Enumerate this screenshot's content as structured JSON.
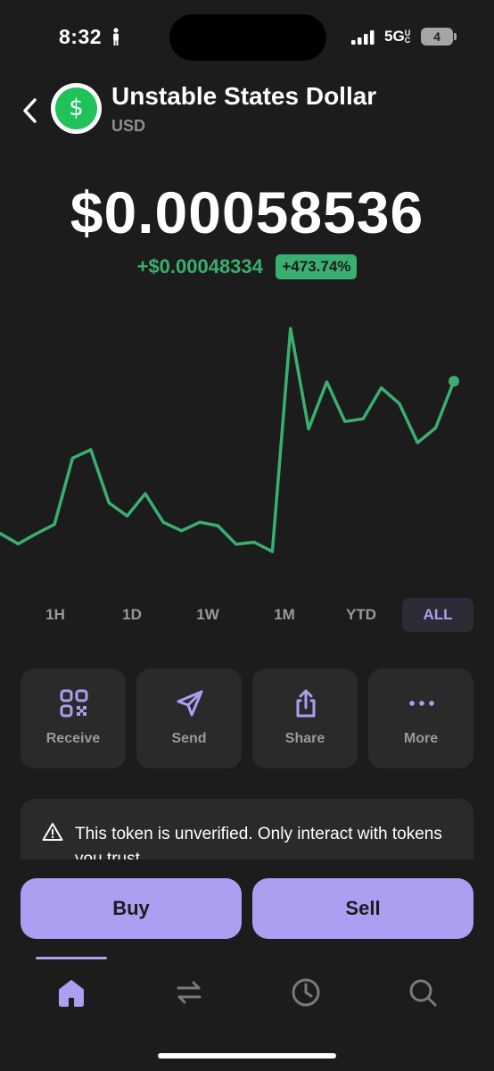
{
  "status": {
    "time": "8:32",
    "network": "5G",
    "network_sup": "UC",
    "battery": "4"
  },
  "token": {
    "name": "Unstable States Dollar",
    "symbol": "USD",
    "logo_glyph": "$"
  },
  "price": "$0.00058536",
  "change": {
    "absolute": "+$0.00048334",
    "percent": "+473.74%"
  },
  "chart_data": {
    "type": "line",
    "color": "#3aaf6f",
    "x": [
      0,
      1,
      2,
      3,
      4,
      5,
      6,
      7,
      8,
      9,
      10,
      11,
      12,
      13,
      14,
      15,
      16,
      17,
      18,
      19,
      20,
      21,
      22,
      23,
      24,
      25,
      26,
      27,
      28,
      29,
      30,
      31,
      32,
      33,
      34,
      35,
      36,
      37,
      38,
      39,
      40,
      41,
      42,
      43,
      44,
      45,
      46,
      47,
      48,
      49,
      50
    ],
    "values": [
      0.000132,
      0.000101,
      0.000131,
      0.000159,
      0.000356,
      0.000381,
      0.000223,
      0.000184,
      0.00025,
      0.000165,
      0.00014,
      0.000165,
      0.000155,
      0.0001,
      0.000106,
      7.8e-05,
      0.000742,
      0.000443,
      0.000583,
      0.000465,
      0.000473,
      0.000565,
      0.000518,
      0.000402,
      0.000446,
      0.000585
    ]
  },
  "timeframes": [
    "1H",
    "1D",
    "1W",
    "1M",
    "YTD",
    "ALL"
  ],
  "active_timeframe": "ALL",
  "actions": [
    {
      "label": "Receive",
      "icon": "qr-code-icon"
    },
    {
      "label": "Send",
      "icon": "send-icon"
    },
    {
      "label": "Share",
      "icon": "share-icon"
    },
    {
      "label": "More",
      "icon": "more-icon"
    }
  ],
  "warning": {
    "text": "This token is unverified. Only interact with tokens you trust."
  },
  "buttons": {
    "buy": "Buy",
    "sell": "Sell"
  },
  "tabs": [
    "home-icon",
    "swap-icon",
    "history-icon",
    "search-icon"
  ],
  "colors": {
    "accent": "#ab9ff2",
    "positive": "#3aaf6f",
    "background": "#1c1c1c",
    "tile": "#2a2a2a"
  }
}
